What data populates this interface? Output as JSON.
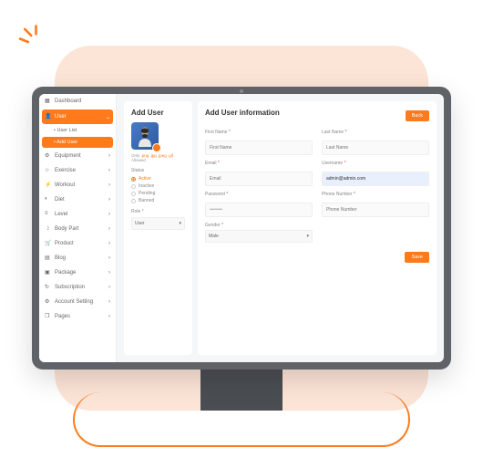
{
  "sidebar": {
    "items": [
      {
        "label": "Dashboard",
        "icon": "grid"
      },
      {
        "label": "User",
        "icon": "user",
        "active": true,
        "expanded": true
      },
      {
        "label": "Equipment",
        "icon": "dumbbell"
      },
      {
        "label": "Exercise",
        "icon": "star"
      },
      {
        "label": "Workout",
        "icon": "activity"
      },
      {
        "label": "Diet",
        "icon": "food"
      },
      {
        "label": "Level",
        "icon": "layers"
      },
      {
        "label": "Body Part",
        "icon": "body"
      },
      {
        "label": "Product",
        "icon": "cart"
      },
      {
        "label": "Blog",
        "icon": "document"
      },
      {
        "label": "Package",
        "icon": "box"
      },
      {
        "label": "Subscription",
        "icon": "refresh"
      },
      {
        "label": "Account Setting",
        "icon": "settings"
      },
      {
        "label": "Pages",
        "icon": "pages"
      }
    ],
    "sub_items": [
      {
        "label": "User List"
      },
      {
        "label": "Add User",
        "active": true
      }
    ]
  },
  "left_panel": {
    "title": "Add User",
    "hint_prefix": "Only",
    "hint_ext": ".png .jpg .jpeg .gif",
    "hint_suffix": "Allowed",
    "status_label": "Status",
    "status_options": [
      "Active",
      "Inactive",
      "Pending",
      "Banned"
    ],
    "status_selected": "Active",
    "role_label": "Role *",
    "role_value": "User"
  },
  "right_panel": {
    "title": "Add User information",
    "back_label": "Back",
    "save_label": "Save",
    "fields": {
      "first_name": {
        "label": "First Name",
        "placeholder": "First Name",
        "required": true
      },
      "last_name": {
        "label": "Last Name",
        "placeholder": "Last Name",
        "required": true
      },
      "email": {
        "label": "Email",
        "placeholder": "Email",
        "required": true
      },
      "username": {
        "label": "Username",
        "value": "admin@admin.com",
        "required": true
      },
      "password": {
        "label": "Password",
        "value": "••••••••",
        "required": true
      },
      "phone": {
        "label": "Phone Number",
        "placeholder": "Phone Number",
        "required": true
      },
      "gender": {
        "label": "Gender",
        "value": "Male",
        "required": true
      }
    }
  },
  "colors": {
    "accent": "#ff7a1a"
  }
}
